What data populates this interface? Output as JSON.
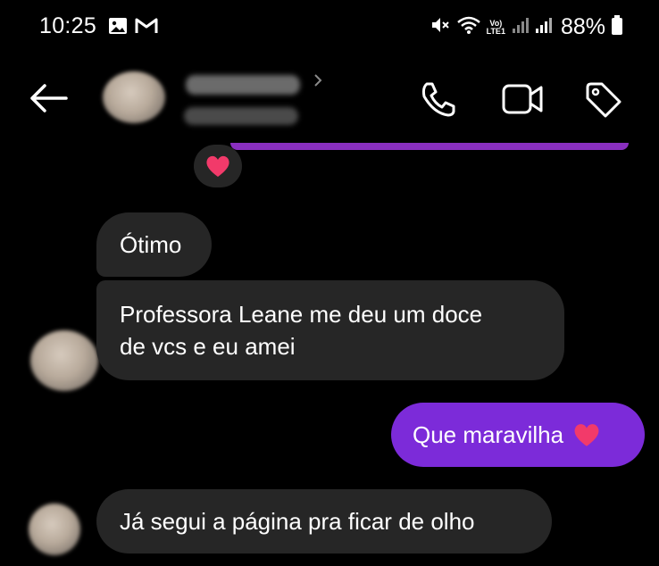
{
  "status_bar": {
    "time": "10:25",
    "battery": "88%",
    "volte_top": "Vo)",
    "volte_bottom": "LTE1",
    "icons": [
      "gallery-icon",
      "gmail-icon",
      "mute-icon",
      "wifi-icon",
      "volte-icon",
      "signal-icon",
      "signal-icon",
      "battery-icon"
    ]
  },
  "header": {
    "icons": [
      "back-arrow-icon",
      "chevron-right-icon",
      "phone-icon",
      "video-camera-icon",
      "tag-icon"
    ]
  },
  "reaction": {
    "emoji": "❤️"
  },
  "messages": [
    {
      "direction": "incoming",
      "text": "Ótimo"
    },
    {
      "direction": "incoming",
      "text_line1": "Professora Leane me deu um doce",
      "text_line2": "de vcs e eu amei"
    },
    {
      "direction": "outgoing",
      "text": "Que maravilha",
      "emoji": "❤️"
    },
    {
      "direction": "incoming",
      "text": "Já segui a página pra ficar de olho"
    }
  ],
  "colors": {
    "background": "#000000",
    "incoming_bubble": "#262626",
    "outgoing_bubble": "#7c2bd9",
    "accent_purple": "#8a2fc0",
    "text": "#ffffff"
  }
}
